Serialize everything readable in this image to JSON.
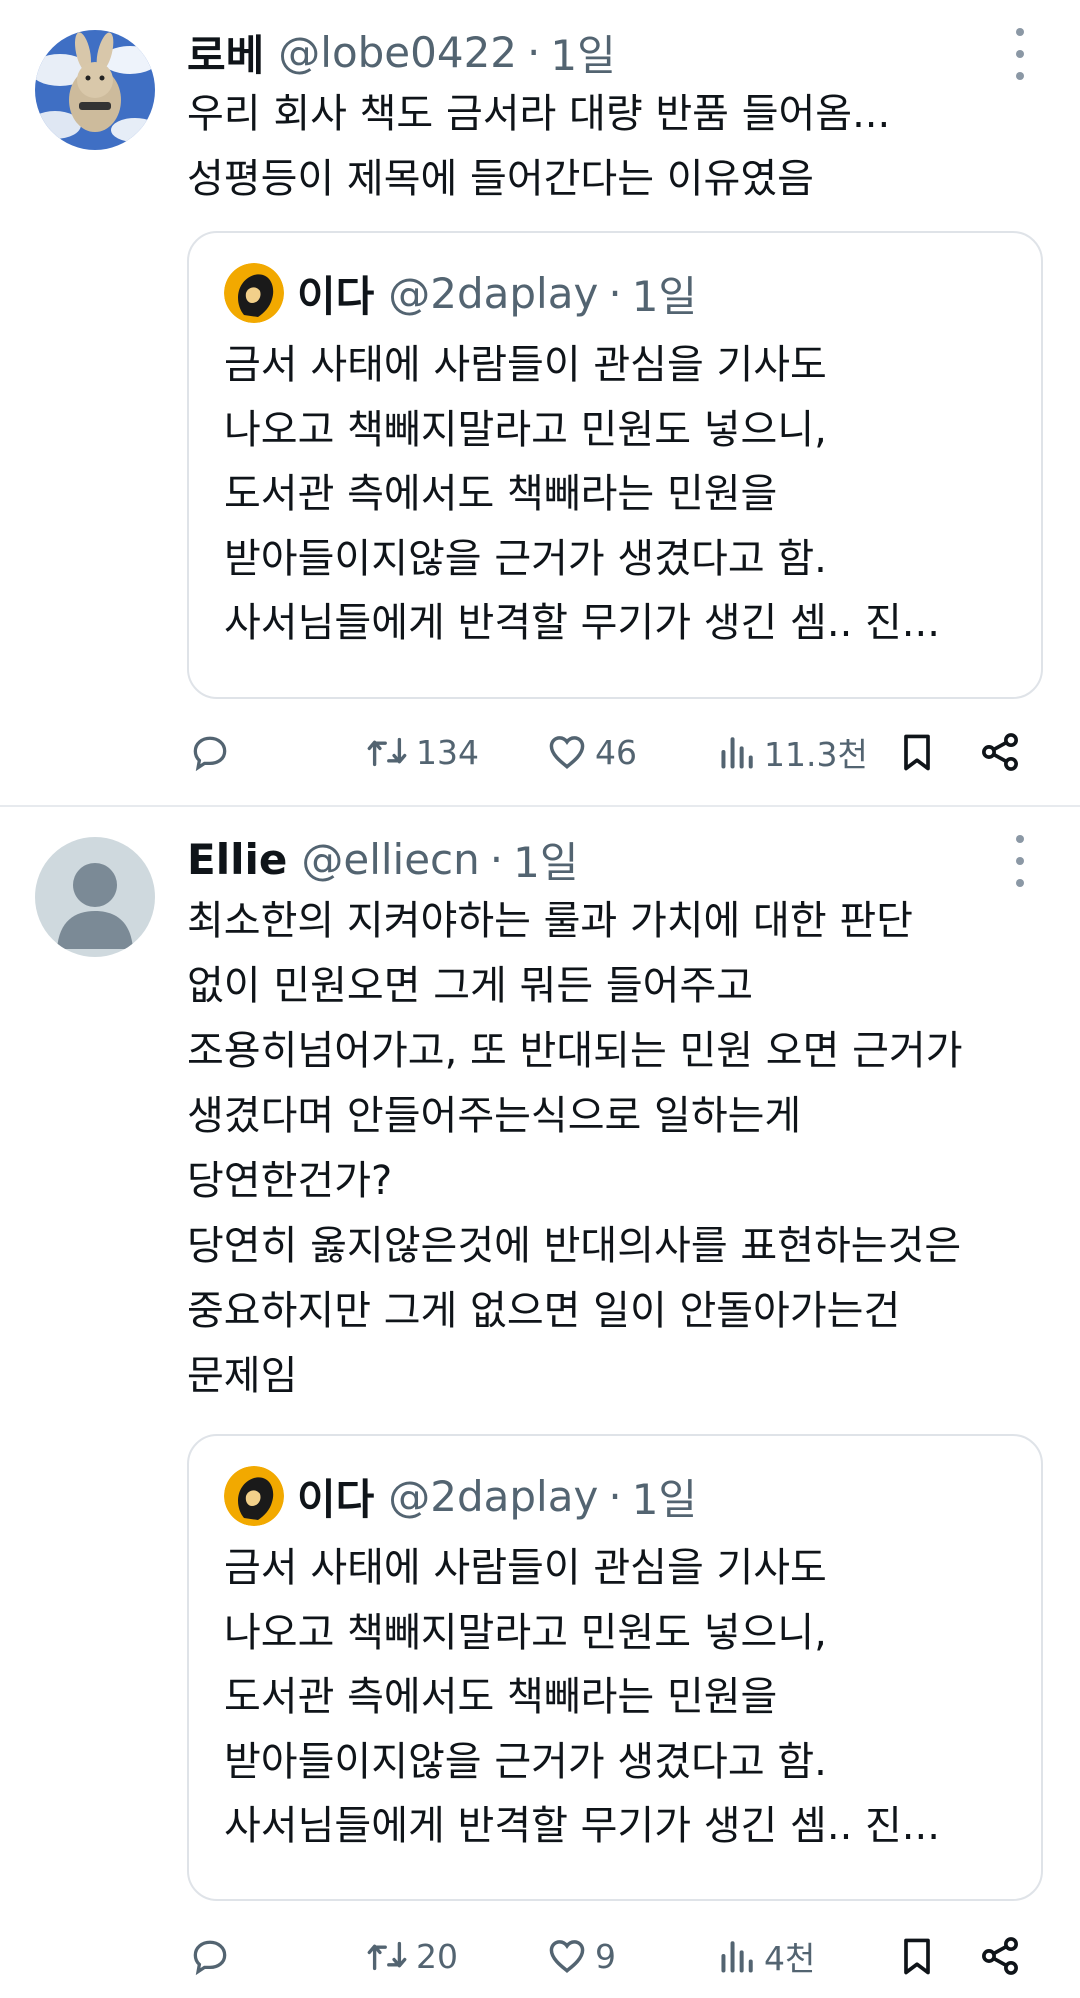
{
  "posts": [
    {
      "author": {
        "name": "로베",
        "handle": "@lobe0422",
        "time": "1일"
      },
      "text": "우리 회사 책도 금서라 대량 반품 들어옴...\n성평등이 제목에 들어간다는 이유였음",
      "quote": {
        "author": {
          "name": "이다",
          "handle": "@2daplay",
          "time": "1일"
        },
        "text": "금서 사태에 사람들이 관심을 기사도\n나오고 책빼지말라고 민원도 넣으니,\n도서관 측에서도 책빼라는 민원을\n받아들이지않을 근거가 생겼다고 함.\n사서님들에게 반격할 무기가 생긴 셈.. 진..."
      },
      "stats": {
        "reposts": "134",
        "likes": "46",
        "views": "11.3천"
      }
    },
    {
      "author": {
        "name": "Ellie",
        "handle": "@elliecn",
        "time": "1일"
      },
      "text": "최소한의 지켜야하는 룰과 가치에 대한 판단\n없이 민원오면 그게 뭐든 들어주고\n조용히넘어가고, 또 반대되는 민원 오면 근거가\n생겼다며 안들어주는식으로 일하는게\n당연한건가?\n당연히 옳지않은것에 반대의사를 표현하는것은\n중요하지만 그게 없으면 일이 안돌아가는건\n문제임",
      "quote": {
        "author": {
          "name": "이다",
          "handle": "@2daplay",
          "time": "1일"
        },
        "text": "금서 사태에 사람들이 관심을 기사도\n나오고 책빼지말라고 민원도 넣으니,\n도서관 측에서도 책빼라는 민원을\n받아들이지않을 근거가 생겼다고 함.\n사서님들에게 반격할 무기가 생긴 셈.. 진..."
      },
      "stats": {
        "reposts": "20",
        "likes": "9",
        "views": "4천"
      }
    }
  ],
  "separator": "·",
  "icons": [
    "reply-icon",
    "repost-icon",
    "like-icon",
    "views-icon",
    "bookmark-icon",
    "share-icon",
    "more-icon"
  ],
  "colors": {
    "text": "#0f1419",
    "secondary": "#536471",
    "border": "#dfe3e8"
  }
}
